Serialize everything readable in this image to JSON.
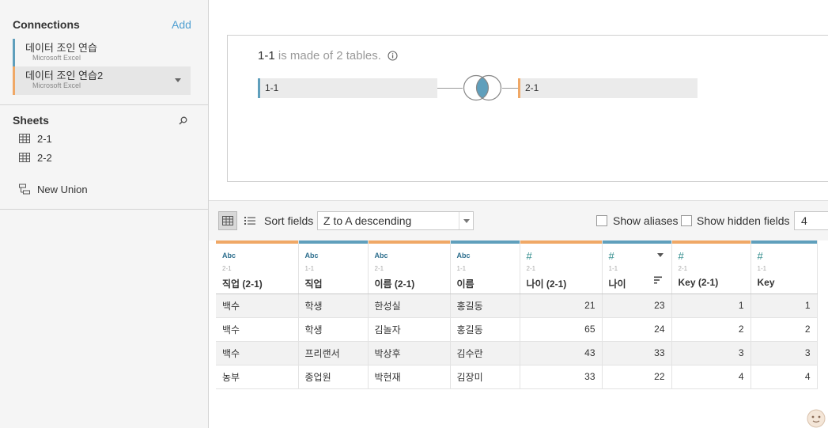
{
  "sidebar": {
    "connections_title": "Connections",
    "add_label": "Add",
    "connections": [
      {
        "name": "데이터 조인 연습",
        "type": "Microsoft Excel"
      },
      {
        "name": "데이터 조인 연습2",
        "type": "Microsoft Excel"
      }
    ],
    "sheets_title": "Sheets",
    "sheets": [
      "2-1",
      "2-2"
    ],
    "new_union": "New Union"
  },
  "canvas": {
    "table_name": "1-1",
    "made_of_text": "is made of 2 tables.",
    "left_table": "1-1",
    "right_table": "2-1"
  },
  "toolbar": {
    "sort_fields_label": "Sort fields",
    "sort_value": "Z to A descending",
    "show_aliases": "Show aliases",
    "show_hidden_fields": "Show hidden fields",
    "rows": "4"
  },
  "colors": {
    "left_source": "#5f9fbc",
    "right_source": "#f0a866"
  },
  "grid": {
    "columns": [
      {
        "type": "Abc",
        "source": "2-1",
        "name": "직업 (2-1)",
        "color": "#f0a866",
        "numeric": false
      },
      {
        "type": "Abc",
        "source": "1-1",
        "name": "직업",
        "color": "#5f9fbc",
        "numeric": false
      },
      {
        "type": "Abc",
        "source": "2-1",
        "name": "이름 (2-1)",
        "color": "#f0a866",
        "numeric": false
      },
      {
        "type": "Abc",
        "source": "1-1",
        "name": "이름",
        "color": "#5f9fbc",
        "numeric": false
      },
      {
        "type": "#",
        "source": "2-1",
        "name": "나이 (2-1)",
        "color": "#f0a866",
        "numeric": true
      },
      {
        "type": "#",
        "source": "1-1",
        "name": "나이",
        "color": "#5f9fbc",
        "numeric": true
      },
      {
        "type": "#",
        "source": "2-1",
        "name": "Key (2-1)",
        "color": "#f0a866",
        "numeric": true
      },
      {
        "type": "#",
        "source": "1-1",
        "name": "Key",
        "color": "#5f9fbc",
        "numeric": true
      }
    ],
    "rows": [
      [
        "백수",
        "학생",
        "한성실",
        "홍길동",
        "21",
        "23",
        "1",
        "1"
      ],
      [
        "백수",
        "학생",
        "김놀자",
        "홍길동",
        "65",
        "24",
        "2",
        "2"
      ],
      [
        "백수",
        "프리랜서",
        "박상후",
        "김수란",
        "43",
        "33",
        "3",
        "3"
      ],
      [
        "농부",
        "종업원",
        "박현재",
        "김장미",
        "33",
        "22",
        "4",
        "4"
      ]
    ]
  }
}
